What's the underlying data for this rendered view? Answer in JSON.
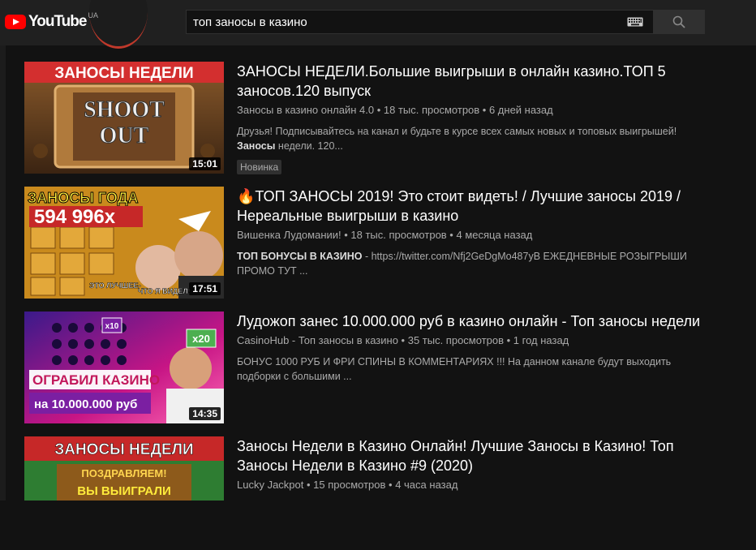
{
  "header": {
    "logo_text": "YouTube",
    "logo_region": "UA",
    "search_value": "топ заносы в казино"
  },
  "results": [
    {
      "thumb_text_top": "ЗАНОСЫ НЕДЕЛИ",
      "thumb_text_mid1": "SHOOT",
      "thumb_text_mid2": "OUT",
      "duration": "15:01",
      "title": "ЗАНОСЫ НЕДЕЛИ.Большие выигрыши в онлайн казино.ТОП 5 заносов.120 выпуск",
      "meta": "Заносы в казино онлайн 4.0 • 18 тыс. просмотров • 6 дней назад",
      "desc_plain": "Друзья! Подписывайтесь на канал и будьте в курсе всех самых новых и топовых выигрышей! ",
      "desc_bold": "Заносы",
      "desc_tail": " недели. 120...",
      "badge": "Новинка"
    },
    {
      "thumb_text_top": "ЗАНОСЫ ГОДА",
      "thumb_text_mid1": "594 996x",
      "thumb_text_cap1": "ЭТО ЛУЧШЕЕ-",
      "thumb_text_cap2": "ЧТО Я ВИДЕЛ!",
      "duration": "17:51",
      "title": "🔥ТОП ЗАНОСЫ 2019! Это стоит видеть! / Лучшие заносы 2019 / Нереальные выигрыши в казино",
      "meta": "Вишенка Лудомании! • 18 тыс. просмотров • 4 месяца назад",
      "desc_pre": "ТОП БОНУСЫ В ",
      "desc_bold": "КАЗИНО",
      "desc_tail": " - https://twitter.com/Nfj2GeDgMo487yB ЕЖЕДНЕВНЫЕ РОЗЫГРЫШИ ПРОМО ТУТ ..."
    },
    {
      "thumb_text_mid1": "ОГРАБИЛ КАЗИНО",
      "thumb_text_mid2": "на 10.000.000 руб",
      "thumb_badge_a": "x10",
      "thumb_badge_b": "x20",
      "duration": "14:35",
      "title": "Лудожоп занес 10.000.000 руб в казино онлайн - Топ заносы недели",
      "meta": "CasinoHub - Топ заносы в казино • 35 тыс. просмотров • 1 год назад",
      "desc": "БОНУС 1000 РУБ И ФРИ СПИНЫ В КОММЕНТАРИЯХ !!! На данном канале будут выходить подборки с большими ..."
    },
    {
      "thumb_text_top": "ЗАНОСЫ НЕДЕЛИ",
      "thumb_text_mid1": "ПОЗДРАВЛЯЕМ!",
      "thumb_text_mid2": "ВЫ ВЫИГРАЛИ",
      "title": "Заносы Недели в Казино Онлайн! Лучшие Заносы в Казино! Топ Заносы Недели в Казино #9 (2020)",
      "meta": "Lucky Jackpot • 15 просмотров • 4 часа назад"
    }
  ],
  "colors": {
    "background": "#121212",
    "topbar": "#202020",
    "brand_red": "#ff0000",
    "text_secondary": "#aaaaaa"
  },
  "icons": {
    "keyboard": "keyboard-icon",
    "search": "search-icon",
    "logo": "youtube-logo-icon"
  }
}
